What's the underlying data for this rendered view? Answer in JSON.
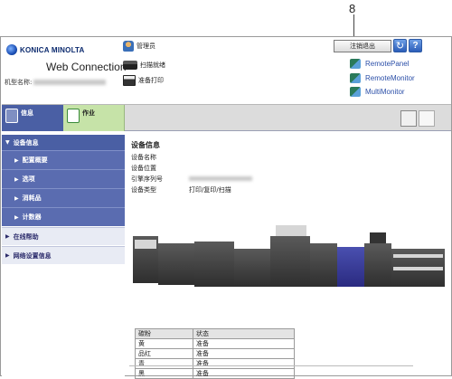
{
  "callout": "8",
  "header": {
    "brand": "KONICA MINOLTA",
    "app_name": "Web Connection",
    "model_label": "机型名称:",
    "admin_label": "管理员",
    "scan_label": "扫描就绪",
    "print_label": "准备打印",
    "logout_label": "注销退出",
    "refresh_icon": "↻",
    "help_icon": "?",
    "remote_links": [
      "RemotePanel",
      "RemoteMonitor",
      "MultiMonitor"
    ]
  },
  "tabs": [
    {
      "label": "信息",
      "icon": "info-icon"
    },
    {
      "label": "作业",
      "icon": "job-icon"
    }
  ],
  "sidebar": {
    "items": [
      {
        "label": "设备信息",
        "level": "top"
      },
      {
        "label": "配置概要",
        "level": "sub"
      },
      {
        "label": "选项",
        "level": "sub"
      },
      {
        "label": "消耗品",
        "level": "sub"
      },
      {
        "label": "计数器",
        "level": "sub"
      },
      {
        "label": "在线帮助",
        "level": "plain"
      },
      {
        "label": "网络设置信息",
        "level": "plain"
      }
    ]
  },
  "main": {
    "title": "设备信息",
    "fields": [
      {
        "key": "设备名称",
        "value": ""
      },
      {
        "key": "设备位置",
        "value": ""
      },
      {
        "key": "引擎序列号",
        "value": ""
      },
      {
        "key": "设备类型",
        "value": "打印/复印/扫描"
      }
    ],
    "table": {
      "headers": [
        "碳粉",
        "状态"
      ],
      "rows": [
        [
          "黄",
          "准备"
        ],
        [
          "品红",
          "准备"
        ],
        [
          "青",
          "准备"
        ],
        [
          "黑",
          "准备"
        ]
      ]
    }
  }
}
